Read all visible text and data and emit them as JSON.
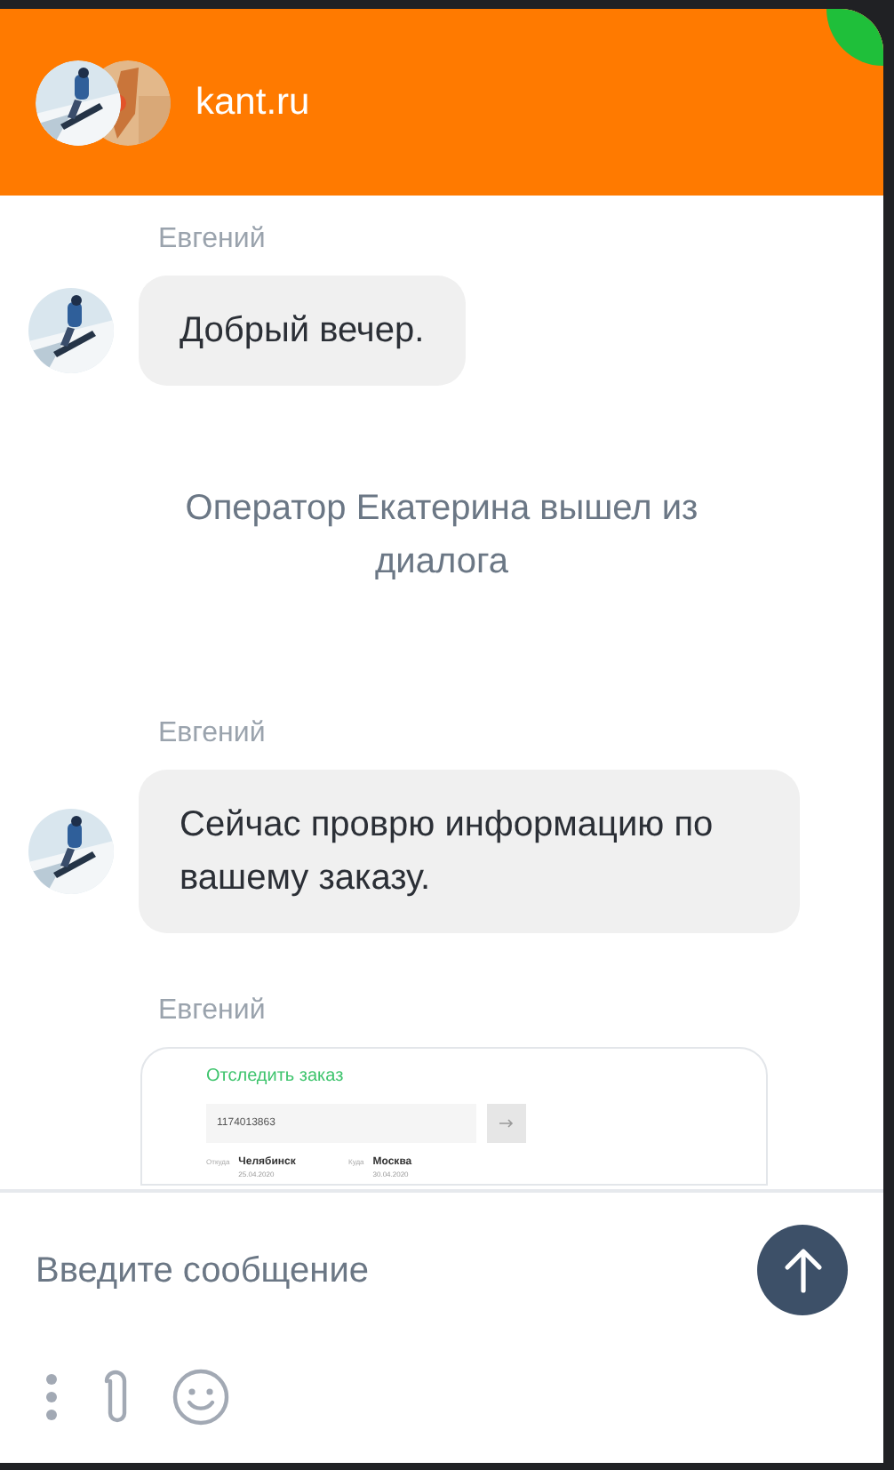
{
  "header": {
    "title": "kant.ru",
    "online": true
  },
  "messages": [
    {
      "kind": "operator",
      "author": "Евгений",
      "text": "Добрый вечер."
    },
    {
      "kind": "system",
      "text": "Оператор Екатерина вышел из диалога"
    },
    {
      "kind": "operator",
      "author": "Евгений",
      "text": "Сейчас проврю информацию по вашему заказу."
    },
    {
      "author": "Евгений",
      "screenshot": {
        "title": "Отследить заказ",
        "order_field": "1174013863",
        "from_label": "Откуда",
        "from_city": "Челябинск",
        "from_date": "25.04.2020",
        "to_label": "Куда",
        "to_city": "Москва",
        "to_date": "30.04.2020"
      }
    }
  ],
  "composer": {
    "placeholder": "Введите сообщение"
  }
}
